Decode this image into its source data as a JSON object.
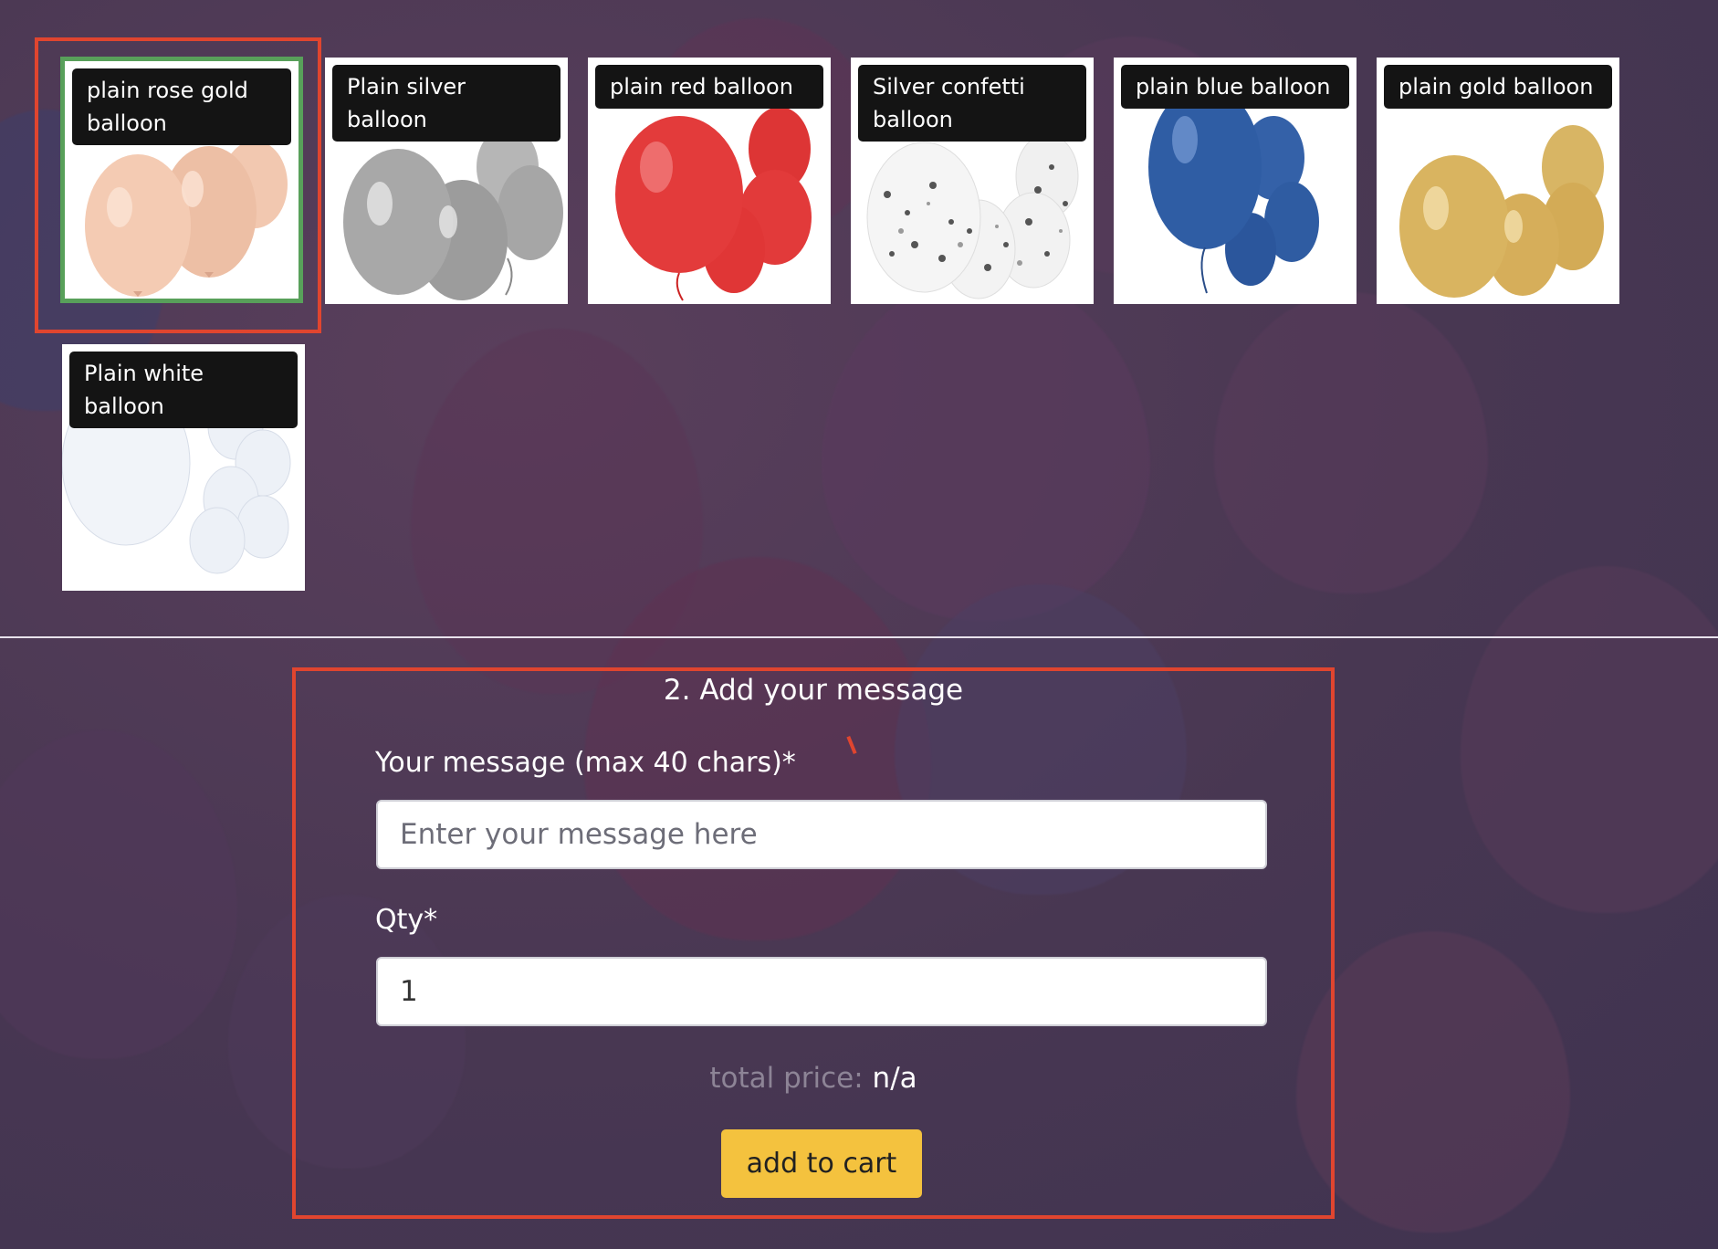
{
  "balloons": [
    {
      "label": "plain rose gold balloon",
      "color": "#f0c2a8",
      "selected": true
    },
    {
      "label": "Plain silver balloon",
      "color": "#b2b2b2",
      "selected": false
    },
    {
      "label": "plain red balloon",
      "color": "#e03a3a",
      "selected": false
    },
    {
      "label": "Silver confetti balloon",
      "color": "#f3f3f3",
      "selected": false
    },
    {
      "label": "plain blue balloon",
      "color": "#2e5aa0",
      "selected": false
    },
    {
      "label": "plain gold balloon",
      "color": "#d9b25c",
      "selected": false
    },
    {
      "label": "Plain white balloon",
      "color": "#eef2f8",
      "selected": false
    }
  ],
  "message_section": {
    "title": "2. Add your message",
    "message_label": "Your message (max 40 chars)*",
    "message_placeholder": "Enter your message here",
    "message_value": "",
    "qty_label": "Qty*",
    "qty_value": "1",
    "total_label": "total price:",
    "total_value": "n/a",
    "add_to_cart_label": "add to cart"
  },
  "colors": {
    "highlight_outline": "#e0452f",
    "selected_border": "#58a05a",
    "button_bg": "#f4c23e"
  }
}
